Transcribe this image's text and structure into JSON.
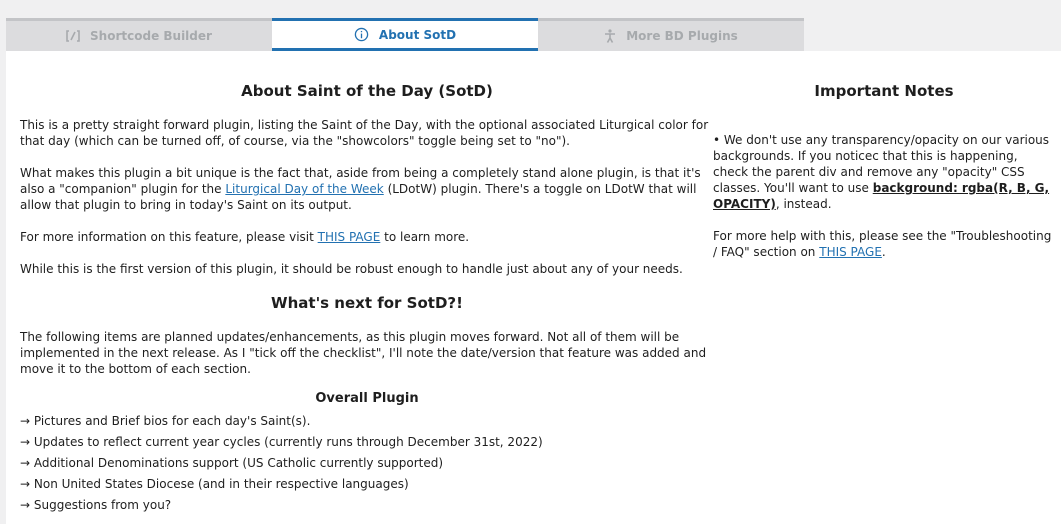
{
  "tabs": [
    {
      "label": "Shortcode Builder",
      "icon": "shortcode-icon",
      "active": false
    },
    {
      "label": "About SotD",
      "icon": "info-icon",
      "active": true
    },
    {
      "label": "More BD Plugins",
      "icon": "accessibility-icon",
      "active": false
    }
  ],
  "about": {
    "title": "About Saint of the Day (SotD)",
    "p1": "This is a pretty straight forward plugin, listing the Saint of the Day, with the optional associated Liturgical color for that day (which can be turned off, of course, via the \"showcolors\" toggle being set to \"no\").",
    "p2_before": "What makes this plugin a bit unique is the fact that, aside from being a completely stand alone plugin, is that it's also a \"companion\" plugin for the ",
    "p2_link": "Liturgical Day of the Week",
    "p2_after": " (LDotW) plugin. There's a toggle on LDotW that will allow that plugin to bring in today's Saint on its output.",
    "p3_before": "For more information on this feature, please visit ",
    "p3_link": "THIS PAGE",
    "p3_after": " to learn more.",
    "p4": "While this is the first version of this plugin, it should be robust enough to handle just about any of your needs."
  },
  "whats_next": {
    "title": "What's next for SotD?!",
    "intro": "The following items are planned updates/enhancements, as this plugin moves forward. Not all of them will be implemented in the next release.  As I \"tick off the checklist\", I'll note the date/version that feature was added and move it to the bottom of each section.",
    "overall_title": "Overall Plugin",
    "items": [
      "→ Pictures and Brief bios for each day's Saint(s).",
      "→ Updates to reflect current year cycles (currently runs through December 31st, 2022)",
      "→ Additional Denominations support (US Catholic currently supported)",
      "→ Non United States Diocese (and in their respective languages)",
      "→ Suggestions from you?"
    ]
  },
  "notes": {
    "title": "Important Notes",
    "n1_before": "• We don't use any transparency/opacity on our various backgrounds. If you noticec that this is happening, check the parent div and remove any \"opacity\" CSS classes. You'll want to use ",
    "n1_code": "background: rgba(R, B, G, OPACITY)",
    "n1_after": ", instead.",
    "n2_before": "For more help with this, please see the \"Troubleshooting / FAQ\" section on ",
    "n2_link": "THIS PAGE",
    "n2_after": "."
  }
}
